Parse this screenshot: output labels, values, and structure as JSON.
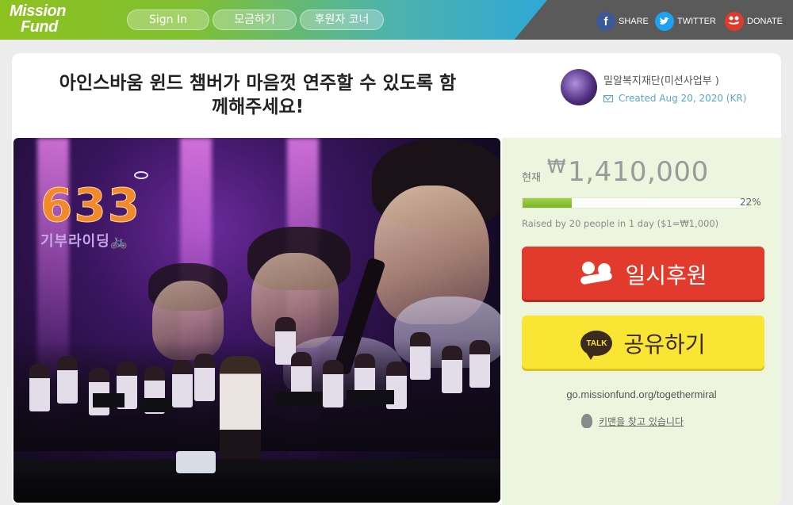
{
  "header": {
    "logo_line1": "Mission",
    "logo_line2": "Fund",
    "nav": [
      {
        "label": "Sign In"
      },
      {
        "label": "모금하기"
      },
      {
        "label": "후원자 코너"
      }
    ],
    "social": {
      "share_label": "SHARE",
      "twitter_label": "TWITTER",
      "donate_label": "DONATE",
      "share_icon": "facebook-icon",
      "twitter_icon": "twitter-icon",
      "donate_icon": "donate-runner-icon"
    }
  },
  "campaign": {
    "title": "아인스바움 윈드 챔버가 마음껏 연주할 수 있도록 함께해주세요!",
    "org_name": "밀알복지재단(미션사업부 )",
    "created": "Created Aug 20, 2020 (KR)",
    "image": {
      "badge_number": "633",
      "badge_text": "기부라이딩🚲"
    }
  },
  "funding": {
    "label": "현재",
    "currency": "₩",
    "amount": "1,410,000",
    "percent": "22%",
    "progress_fraction": 0.22,
    "raised_by": "Raised by 20 people in 1 day ($1=₩1,000)"
  },
  "actions": {
    "donate_label": "일시후원",
    "share_label": "공유하기",
    "talk_icon_text": "TALK",
    "url": "go.missionfund.org/togethermiral",
    "keyman_label": "키맨을 찾고 있습니다"
  },
  "colors": {
    "brand_green": "#8dc21f",
    "donate_red": "#e23b2e",
    "kakao_yellow": "#f9e534",
    "panel_bg": "#eef5de"
  }
}
